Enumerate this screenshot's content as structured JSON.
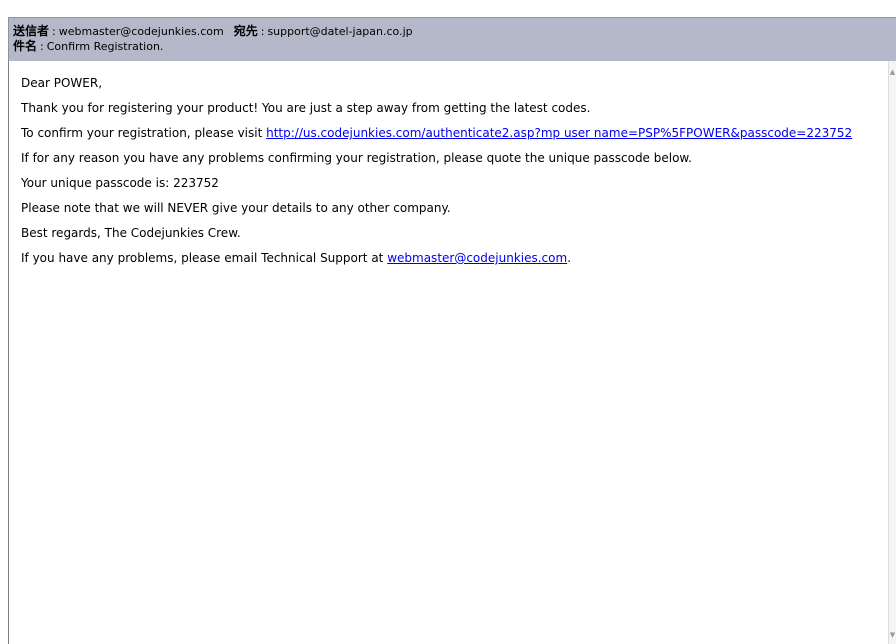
{
  "header": {
    "from_label": "送信者",
    "from_value": "webmaster@codejunkies.com",
    "to_label": "宛先",
    "to_value": "support@datel-japan.co.jp",
    "subject_label": "件名",
    "subject_value": "Confirm Registration.",
    "separator": ":"
  },
  "message": {
    "greeting": "Dear POWER,",
    "para1": "Thank you for registering your product! You are just a step away from getting the latest codes.",
    "para2_prefix": "To confirm your registration, please visit ",
    "para2_link": "http://us.codejunkies.com/authenticate2.asp?mp user name=PSP%5FPOWER&passcode=223752",
    "para3": "If for any reason you have any problems confirming your registration, please quote the unique passcode below.",
    "para4": "Your unique passcode is: 223752",
    "para5": "Please note that we will NEVER give your details to any other company.",
    "para6": "Best regards, The Codejunkies Crew.",
    "para7_prefix": "If you have any problems, please email Technical Support at ",
    "para7_link": "webmaster@codejunkies.com",
    "para7_suffix": "."
  },
  "scrollbar": {
    "up_icon": "chevron-up-icon",
    "down_icon": "chevron-down-icon"
  },
  "colors": {
    "header_bg": "#b5b8c8",
    "link": "#0000ee"
  }
}
